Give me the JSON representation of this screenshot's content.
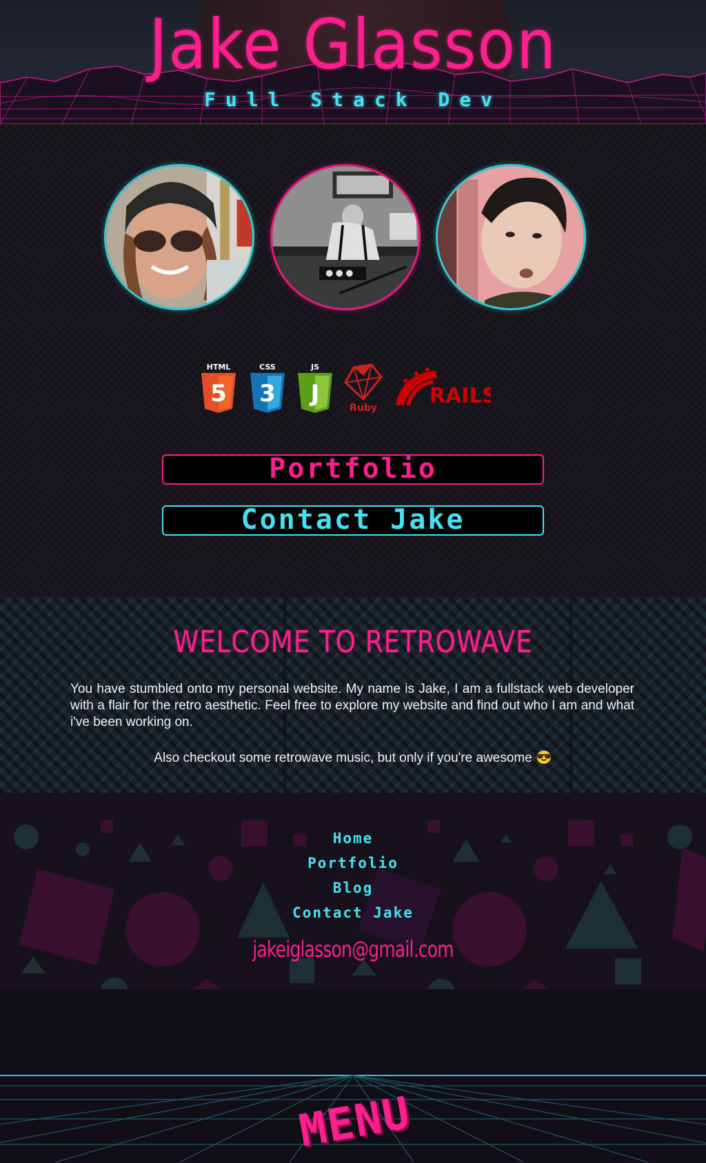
{
  "header": {
    "title": "Jake Glasson",
    "subtitle": "Full Stack Dev"
  },
  "photos": [
    {
      "name": "profile-photo-sunglasses",
      "description": "Selfie with sunglasses and helmet"
    },
    {
      "name": "profile-photo-billiards",
      "description": "Black and white billiards photo"
    },
    {
      "name": "profile-photo-closeup",
      "description": "Close-up portrait"
    }
  ],
  "tech": {
    "html": {
      "label": "HTML",
      "glyph": "5"
    },
    "css": {
      "label": "CSS",
      "glyph": "3"
    },
    "js": {
      "label": "JS",
      "glyph": "J"
    },
    "ruby": {
      "label": "Ruby"
    },
    "rails": {
      "label": "RAILS"
    }
  },
  "buttons": {
    "portfolio": "Portfolio",
    "contact": "Contact Jake"
  },
  "welcome": {
    "title": "WELCOME TO RETROWAVE",
    "body": "You have stumbled onto my personal website. My name is Jake, I am a fullstack web developer with a flair for the retro aesthetic. Feel free to explore my website and find out who I am and what i've been working on.",
    "note": "Also checkout some retrowave music, but only if you're awesome 😎"
  },
  "footer": {
    "links": [
      "Home",
      "Portfolio",
      "Blog",
      "Contact Jake"
    ],
    "email": "jakeiglasson@gmail.com"
  },
  "menu": {
    "label": "MENU"
  },
  "colors": {
    "pink": "#ff1f8e",
    "cyan": "#48e0f0",
    "background": "#15121c"
  }
}
